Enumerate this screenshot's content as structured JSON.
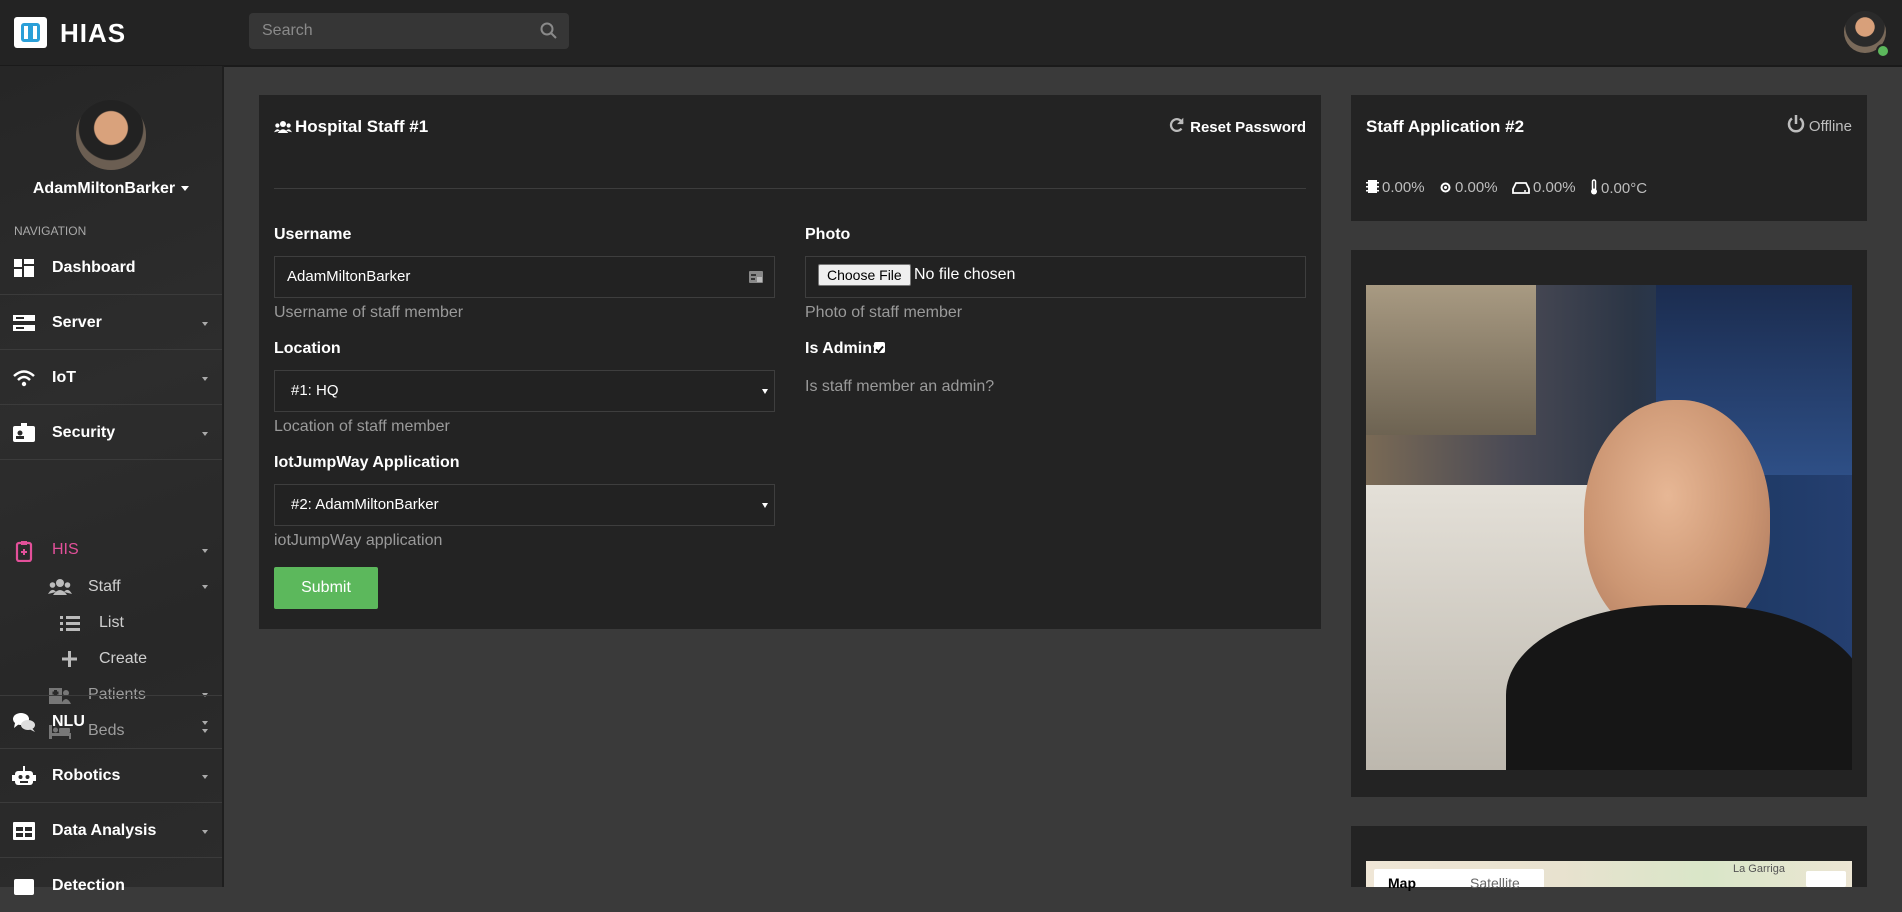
{
  "app": {
    "brand": "HIAS",
    "search_placeholder": "Search"
  },
  "sidebar": {
    "user": "AdamMiltonBarker",
    "nav_caption": "NAVIGATION",
    "items": [
      {
        "label": "Dashboard",
        "icon": "dashboard-icon"
      },
      {
        "label": "Server",
        "icon": "server-icon"
      },
      {
        "label": "IoT",
        "icon": "wifi-icon"
      },
      {
        "label": "Security",
        "icon": "id-badge-icon"
      },
      {
        "label": "HIS",
        "icon": "hospital-icon",
        "active": true,
        "active_color": "#e3509a"
      },
      {
        "label": "NLU",
        "icon": "comments-icon"
      },
      {
        "label": "Robotics",
        "icon": "robot-icon"
      },
      {
        "label": "Data Analysis",
        "icon": "table-icon"
      },
      {
        "label": "Detection",
        "icon": "detection-icon"
      }
    ],
    "his_sub": {
      "staff": "Staff",
      "list": "List",
      "create": "Create",
      "patients": "Patients",
      "beds": "Beds"
    }
  },
  "staff_form": {
    "title": "Hospital Staff #1",
    "reset_password": "Reset Password",
    "username_label": "Username",
    "username_value": "AdamMiltonBarker",
    "username_help": "Username of staff member",
    "location_label": "Location",
    "location_value": "#1: HQ",
    "location_help": "Location of staff member",
    "app_label": "IotJumpWay Application",
    "app_value": "#2: AdamMiltonBarker",
    "app_help": "iotJumpWay application",
    "photo_label": "Photo",
    "choose_file": "Choose File",
    "no_file": "No file chosen",
    "photo_help": "Photo of staff member",
    "is_admin_label": "Is Admin:",
    "is_admin_checked": true,
    "is_admin_help": "Is staff member an admin?",
    "submit": "Submit"
  },
  "application": {
    "title": "Staff Application #2",
    "status": "Offline",
    "cpu": "0.00%",
    "memory": "0.00%",
    "disk": "0.00%",
    "temperature": "0.00°C"
  },
  "map": {
    "place_label": "La Garriga",
    "map_tab": "Map",
    "satellite_tab": "Satellite"
  },
  "colors": {
    "accent_pink": "#e3509a",
    "submit_green": "#5cb85c",
    "card_bg": "#232323",
    "page_bg": "#3a3a3a"
  }
}
